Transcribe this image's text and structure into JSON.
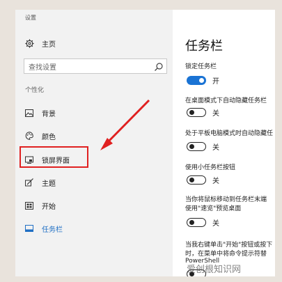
{
  "window": {
    "title": "设置"
  },
  "sidebar": {
    "home_label": "主页",
    "search_placeholder": "查找设置",
    "section_label": "个性化",
    "items": [
      {
        "label": "背景",
        "icon": "image-icon"
      },
      {
        "label": "颜色",
        "icon": "palette-icon"
      },
      {
        "label": "锁屏界面",
        "icon": "lock-screen-icon"
      },
      {
        "label": "主题",
        "icon": "theme-icon"
      },
      {
        "label": "开始",
        "icon": "start-icon"
      },
      {
        "label": "任务栏",
        "icon": "taskbar-icon"
      }
    ]
  },
  "main": {
    "title": "任务栏",
    "settings": [
      {
        "label": "锁定任务栏",
        "state": "开",
        "on": true
      },
      {
        "label": "在桌面模式下自动隐藏任务栏",
        "state": "关",
        "on": false
      },
      {
        "label": "处于平板电脑模式时自动隐藏任",
        "state": "关",
        "on": false
      },
      {
        "label": "使用小任务栏按钮",
        "state": "关",
        "on": false
      },
      {
        "label_lines": [
          "当你将鼠标移动到任务栏末端",
          "使用\"速览\"预览桌面"
        ],
        "state": "关",
        "on": false
      },
      {
        "label_lines": [
          "当我右键单击\"开始\"按钮或按下",
          "时，在菜单中将命令提示符替",
          "PowerShell"
        ],
        "on": false
      }
    ]
  },
  "colors": {
    "accent": "#1a73d4",
    "highlight": "#e02020"
  },
  "watermark": "爱创根知识网"
}
